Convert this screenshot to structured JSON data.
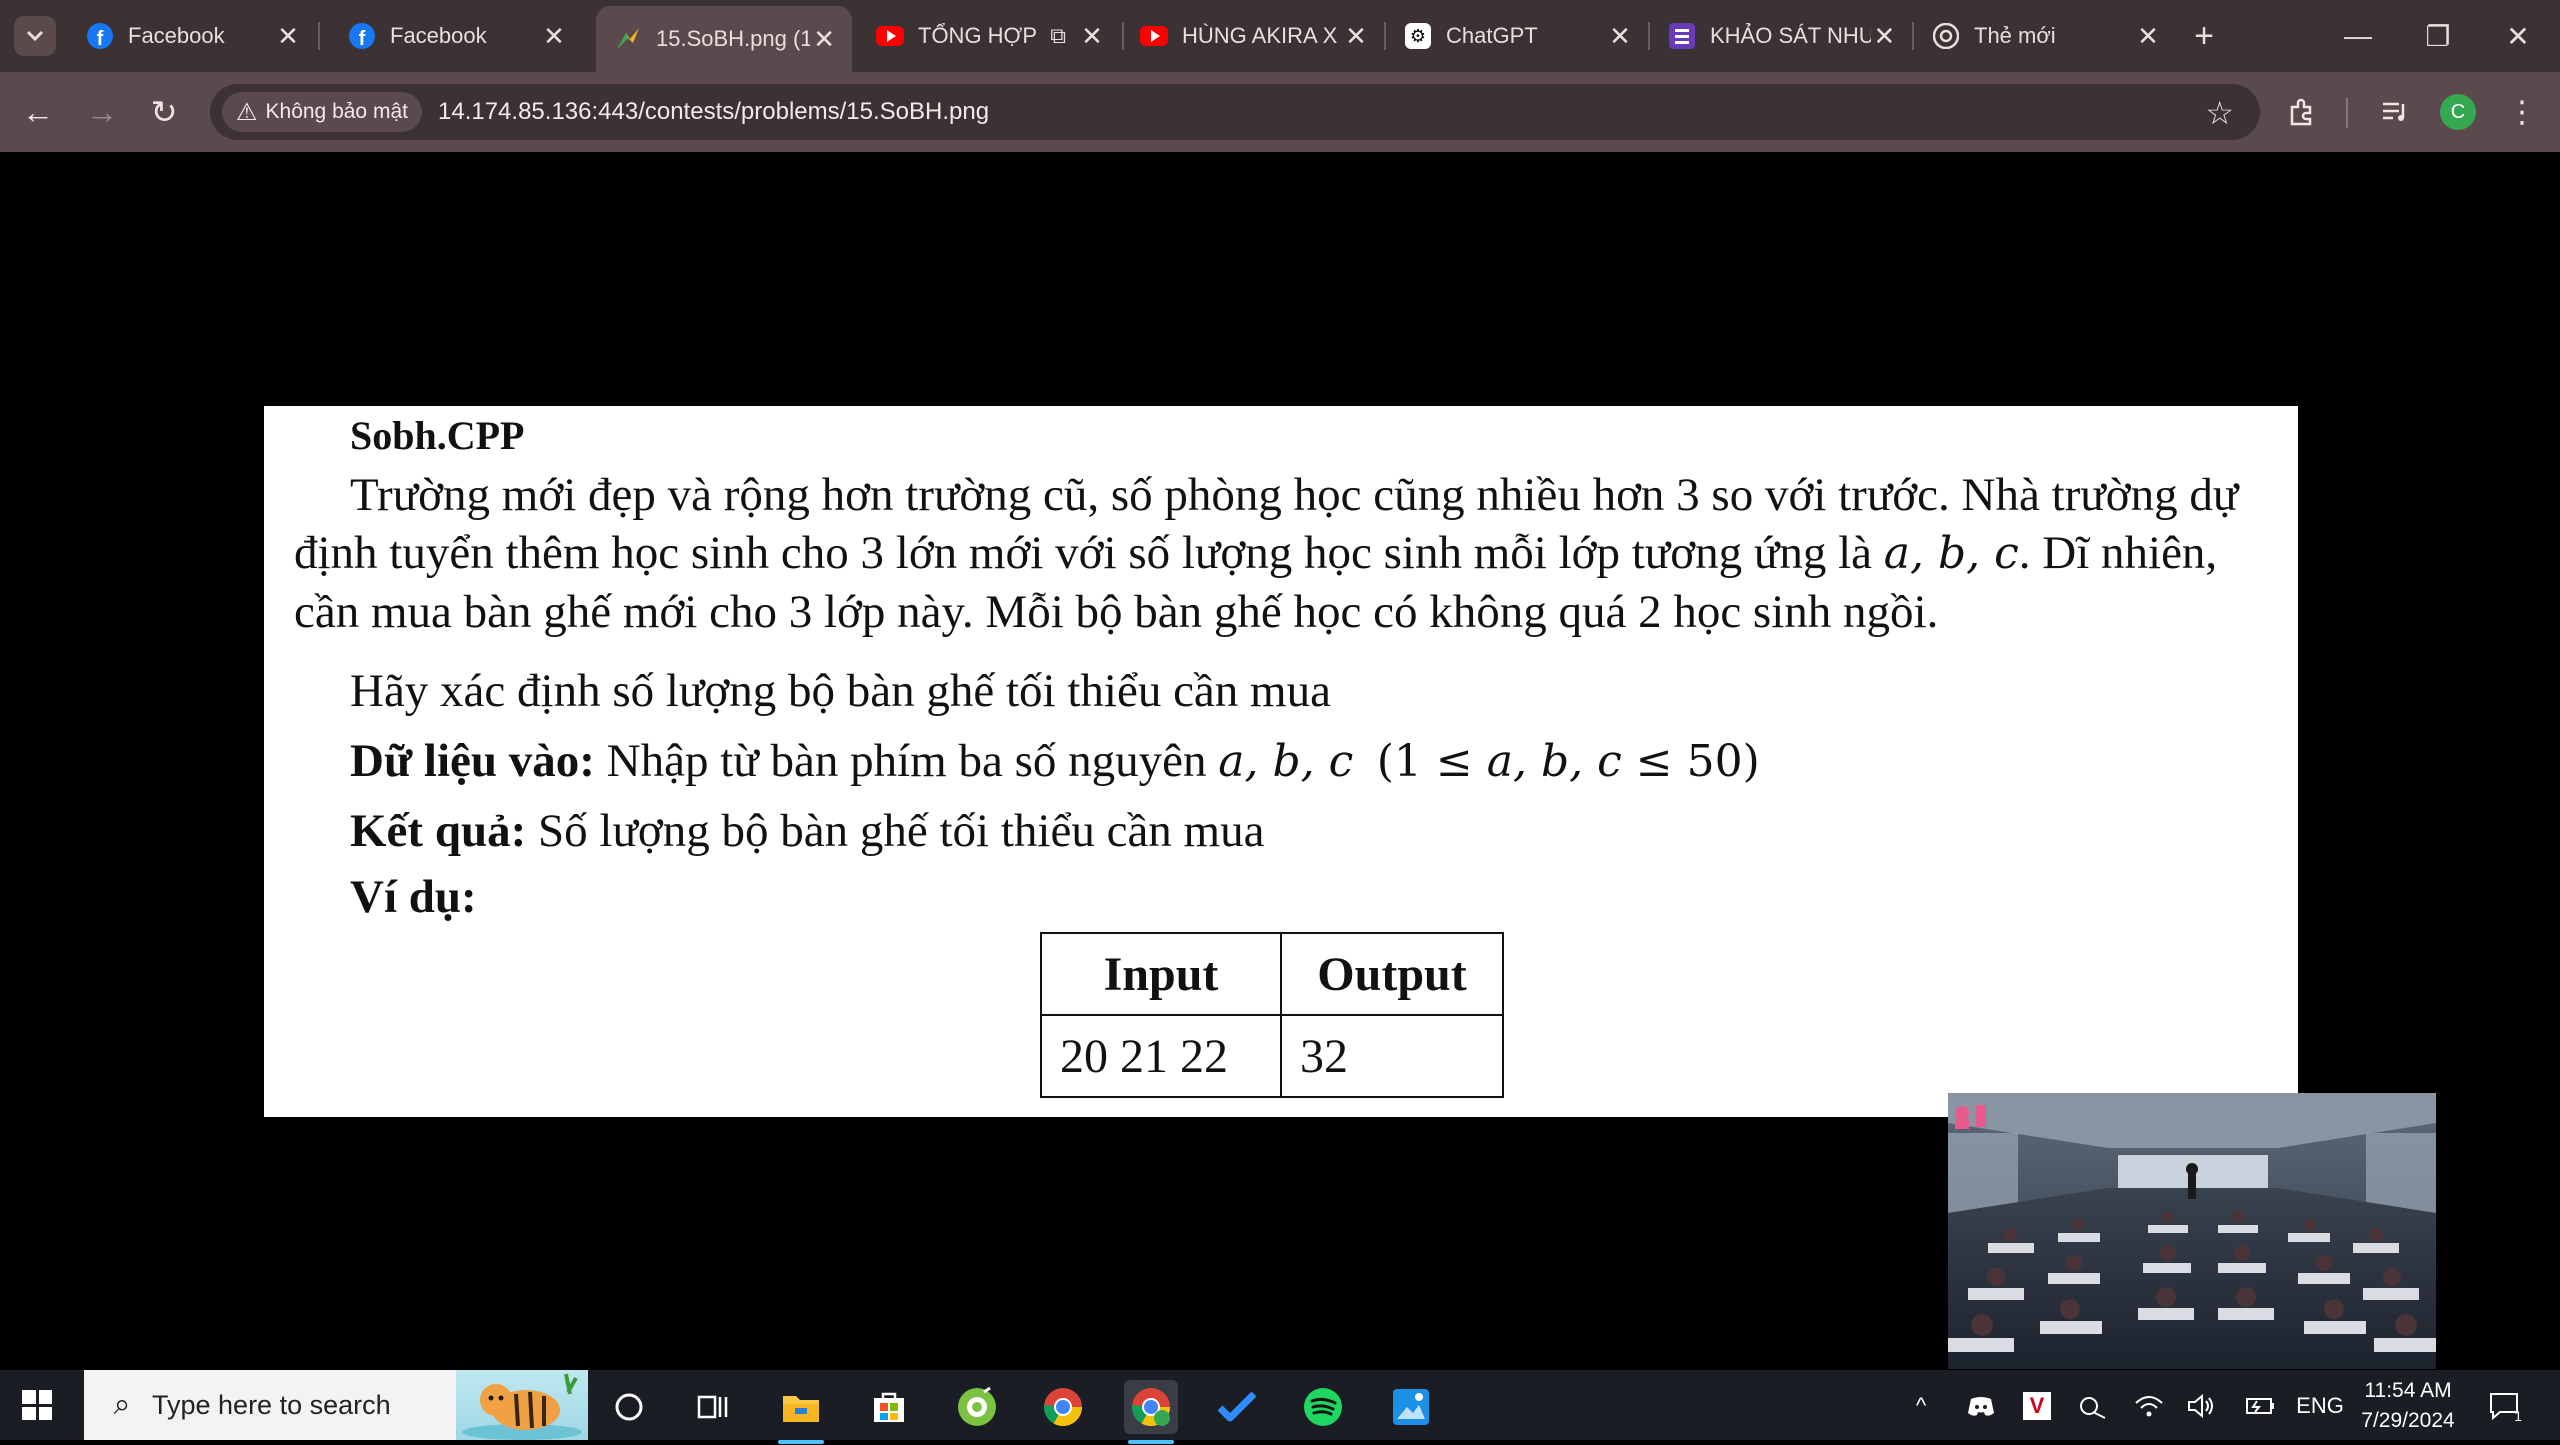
{
  "browser": {
    "tabs": [
      {
        "title": "Facebook",
        "icon": "facebook-icon"
      },
      {
        "title": "Facebook",
        "icon": "facebook-icon"
      },
      {
        "title": "15.SoBH.png (1",
        "icon": "contest-site-icon"
      },
      {
        "title": "TỔNG HỢP",
        "icon": "youtube-icon"
      },
      {
        "title": "HÙNG AKIRA X",
        "icon": "youtube-icon"
      },
      {
        "title": "ChatGPT",
        "icon": "chatgpt-icon"
      },
      {
        "title": "KHẢO SÁT NHU",
        "icon": "google-forms-icon"
      },
      {
        "title": "Thẻ mới",
        "icon": "chrome-icon"
      }
    ],
    "active_tab_index": 2,
    "security_label": "Không bảo mật",
    "url": "14.174.85.136:443/contests/problems/15.SoBH.png",
    "profile_initial": "C",
    "accent_color": "#5b4a4d"
  },
  "problem": {
    "title": "Sobh.CPP",
    "paragraph_1_before_vars": "Trường mới đẹp và rộng hơn trường cũ, số phòng học cũng nhiều hơn 3 so với trước. Nhà trường dự định tuyển thêm học sinh cho 3 lớn mới với số lượng học sinh mỗi lớp tương ứng là ",
    "paragraph_1_vars": "a, b, c",
    "paragraph_1_after_vars": ". Dĩ nhiên, cần mua bàn ghế mới cho 3 lớp này. Mỗi bộ bàn ghế học có không quá 2 học sinh ngồi.",
    "task_line": "Hãy xác định số lượng bộ bàn ghế tối thiểu cần mua",
    "input_label": "Dữ liệu vào:",
    "input_text": " Nhập từ bàn phím ba số nguyên ",
    "input_vars": "a, b, c",
    "input_constraint_open": "(1 ≤ ",
    "input_constraint_vars": "a, b, c",
    "input_constraint_close": " ≤ 50)",
    "output_label": "Kết quả:",
    "output_text": " Số lượng bộ bàn ghế tối thiểu cần mua",
    "example_label": "Ví dụ:",
    "table": {
      "headers": [
        "Input",
        "Output"
      ],
      "rows": [
        [
          "20 21 22",
          "32"
        ]
      ]
    }
  },
  "taskbar": {
    "search_placeholder": "Type here to search",
    "language": "ENG",
    "time": "11:54 AM",
    "date": "7/29/2024",
    "notification_count": "1",
    "pinned_apps": [
      "cortana-icon",
      "task-view-icon",
      "file-explorer-icon",
      "microsoft-store-icon",
      "coccoc-icon",
      "chrome-icon",
      "chrome-profile-icon",
      "todo-icon",
      "spotify-icon",
      "photos-icon"
    ]
  }
}
